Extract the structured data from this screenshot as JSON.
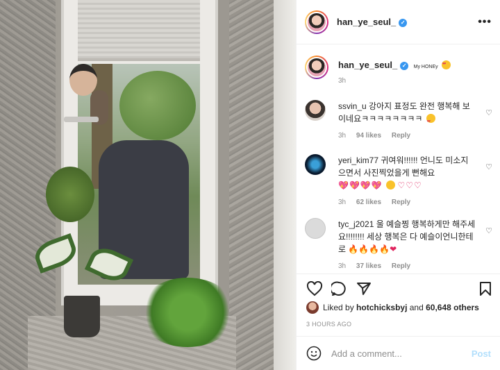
{
  "post": {
    "username": "han_ye_seul_",
    "more_label": "•••"
  },
  "caption": {
    "username": "han_ye_seul_",
    "text": "My HONEy",
    "time": "3h"
  },
  "comments": [
    {
      "username": "ssvin_u",
      "text": "강아지 표정도 완전 행복해 보이네요ㅋㅋㅋㅋㅋㅋㅋㅋ",
      "time": "3h",
      "likes": "94 likes",
      "reply": "Reply"
    },
    {
      "username": "yeri_kim77",
      "text": "귀여워!!!!!! 언니도 미소지으면서 사진찍었을게 뻔해요",
      "hearts": "💖💖💖💖",
      "tail": "♡♡♡",
      "time": "3h",
      "likes": "62 likes",
      "reply": "Reply"
    },
    {
      "username": "tyc_j2021",
      "text": "울 예슬찡 행복하게만 해주세요!!!!!!!! 세상 행복은 다 예슬이언니한테로",
      "fire": "🔥🔥🔥🔥",
      "heart": "❤",
      "time": "3h",
      "likes": "37 likes",
      "reply": "Reply"
    }
  ],
  "likes": {
    "prefix": "Liked by",
    "user": "hotchicksbyj",
    "joiner": "and",
    "count": "60,648 others"
  },
  "timestamp": "3 HOURS AGO",
  "add_comment": {
    "placeholder": "Add a comment...",
    "post_label": "Post"
  },
  "colors": {
    "verified": "#3897f0",
    "post_disabled": "#b2dffc",
    "meta_gray": "#8e8e8e"
  },
  "icons": [
    "heart-icon",
    "comment-icon",
    "share-icon",
    "bookmark-icon",
    "verified-icon",
    "emoji-icon",
    "more-icon"
  ]
}
